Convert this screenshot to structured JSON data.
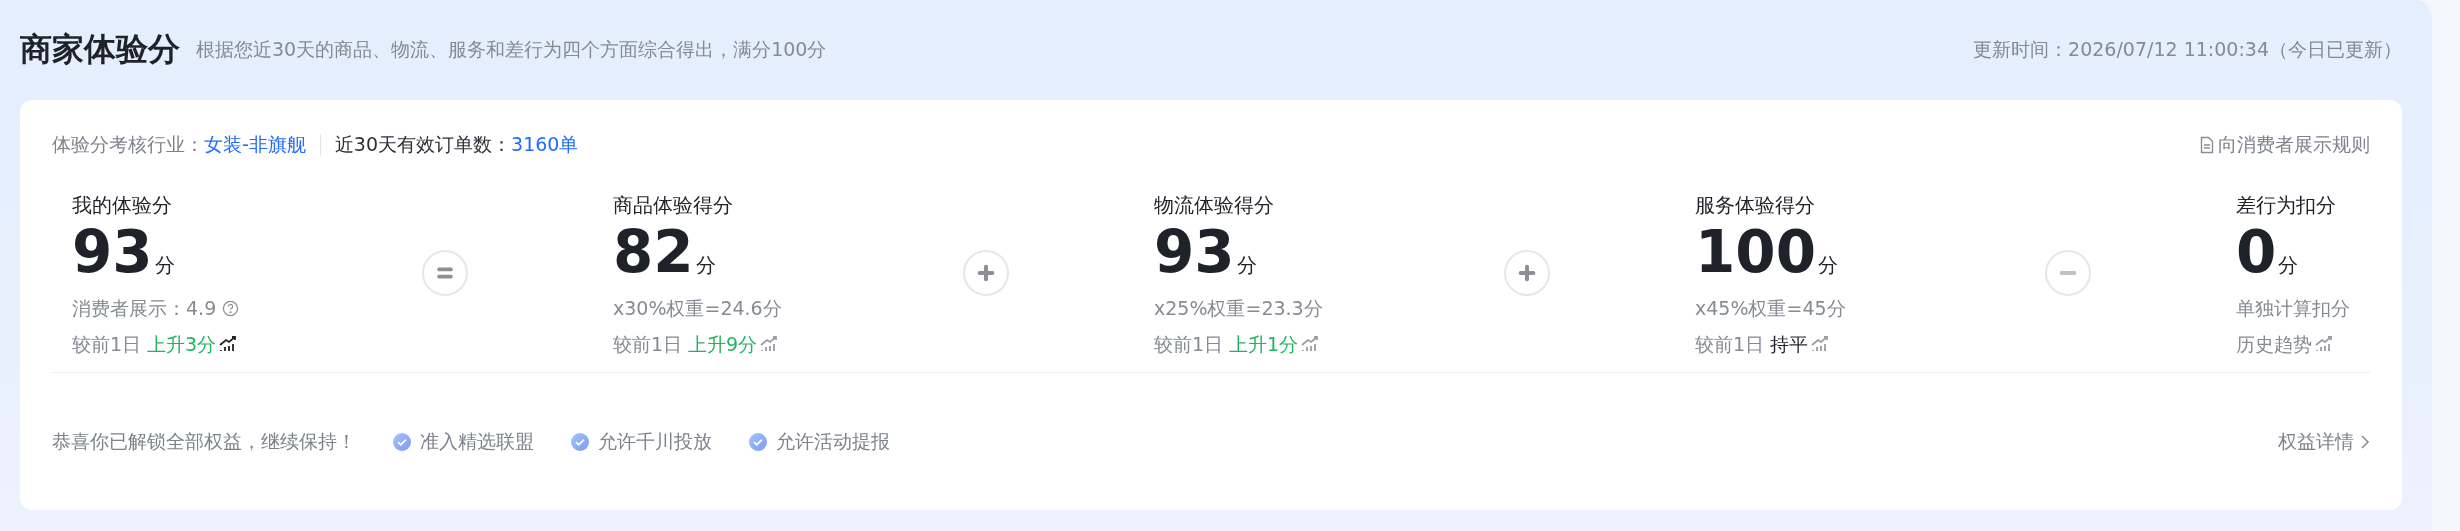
{
  "header": {
    "title": "商家体验分",
    "subtitle": "根据您近30天的商品、物流、服务和差行为四个方面综合得出，满分100分",
    "updated": "更新时间：2026/07/12 11:00:34（今日已更新）"
  },
  "info": {
    "industry_label": "体验分考核行业：",
    "industry_value": "女装-非旗舰",
    "orders_label": "近30天有效订单数：",
    "orders_value": "3160单",
    "rules_link": "向消费者展示规则"
  },
  "metrics": [
    {
      "label": "我的体验分",
      "value": "93",
      "unit": "分",
      "detail": "消费者展示：4.9",
      "detail_help": true,
      "trend_prefix": "较前1日",
      "trend_change": "上升3分",
      "rising": true,
      "trend_icon_dark": true,
      "operator": {
        "kind": "equals"
      }
    },
    {
      "label": "商品体验得分",
      "value": "82",
      "unit": "分",
      "detail": "x30%权重=24.6分",
      "detail_help": false,
      "trend_prefix": "较前1日",
      "trend_change": "上升9分",
      "rising": true,
      "trend_icon_dark": false,
      "operator": {
        "kind": "plus"
      }
    },
    {
      "label": "物流体验得分",
      "value": "93",
      "unit": "分",
      "detail": "x25%权重=23.3分",
      "detail_help": false,
      "trend_prefix": "较前1日",
      "trend_change": "上升1分",
      "rising": true,
      "trend_icon_dark": false,
      "operator": {
        "kind": "plus"
      }
    },
    {
      "label": "服务体验得分",
      "value": "100",
      "unit": "分",
      "detail": "x45%权重=45分",
      "detail_help": false,
      "trend_prefix": "较前1日",
      "trend_change": "持平",
      "rising": false,
      "trend_icon_dark": false,
      "operator": {
        "kind": "minus"
      }
    },
    {
      "label": "差行为扣分",
      "value": "0",
      "unit": "分",
      "detail": "单独计算扣分",
      "detail_help": false,
      "trend_prefix": "历史趋势",
      "trend_icon_dark": false
    }
  ],
  "footer": {
    "message": "恭喜你已解锁全部权益，继续保持！",
    "benefits": [
      "准入精选联盟",
      "允许千川投放",
      "允许活动提报"
    ],
    "details_link": "权益详情"
  }
}
